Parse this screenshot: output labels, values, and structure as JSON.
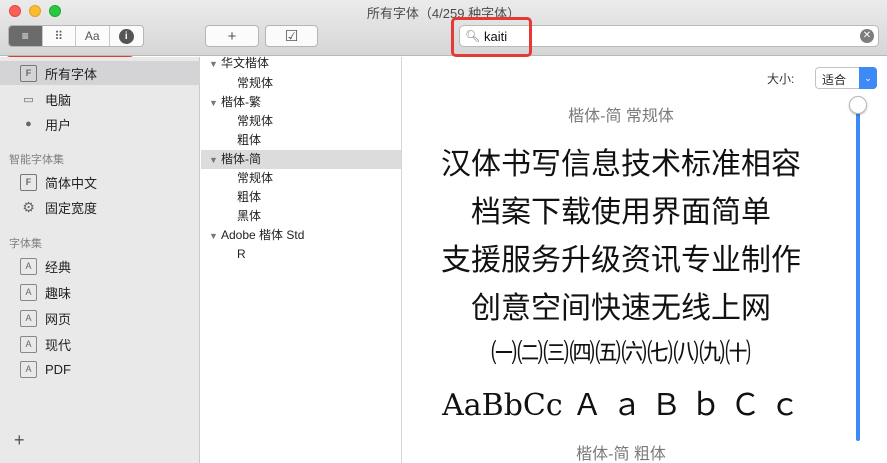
{
  "window": {
    "title": "所有字体（4/259 种字体）"
  },
  "toolbar": {
    "view_buttons": [
      "≡",
      "⠿",
      "Aa",
      "i"
    ],
    "add_label": "+",
    "validate_label": "☑"
  },
  "search": {
    "value": "kaiti",
    "placeholder": ""
  },
  "sidebar": {
    "items": [
      {
        "label": "所有字体",
        "icon": "F"
      },
      {
        "label": "电脑",
        "icon": "▭"
      },
      {
        "label": "用户",
        "icon": "●"
      }
    ],
    "smart_header": "智能字体集",
    "smart_items": [
      {
        "label": "简体中文",
        "icon": "F"
      },
      {
        "label": "固定宽度",
        "icon": "⚙"
      }
    ],
    "collections_header": "字体集",
    "collections": [
      {
        "label": "经典",
        "icon": "A"
      },
      {
        "label": "趣味",
        "icon": "A"
      },
      {
        "label": "网页",
        "icon": "A"
      },
      {
        "label": "现代",
        "icon": "A"
      },
      {
        "label": "PDF",
        "icon": "A"
      }
    ],
    "add_label": "+"
  },
  "fontlist": {
    "families": [
      {
        "name": "华文楷体",
        "faces": [
          "常规体"
        ]
      },
      {
        "name": "楷体-繁",
        "faces": [
          "常规体",
          "粗体"
        ]
      },
      {
        "name": "楷体-简",
        "faces": [
          "常规体",
          "粗体",
          "黑体"
        ]
      },
      {
        "name": "Adobe 楷体 Std",
        "faces": [
          "R"
        ]
      }
    ]
  },
  "preview": {
    "size_label": "大小:",
    "size_value": "适合",
    "heading": "楷体-简 常规体",
    "lines": [
      "汉体书写信息技术标准相容",
      "档案下载使用界面简单",
      "支援服务升级资讯专业制作",
      "创意空间快速无线上网",
      "㈠㈡㈢㈣㈤㈥㈦㈧㈨㈩",
      "AaBbCc Ａ ａ Ｂ ｂ Ｃ ｃ"
    ],
    "next_heading": "楷体-简 粗体"
  },
  "colors": {
    "highlight": "#e53935",
    "accent": "#3d8af7"
  }
}
